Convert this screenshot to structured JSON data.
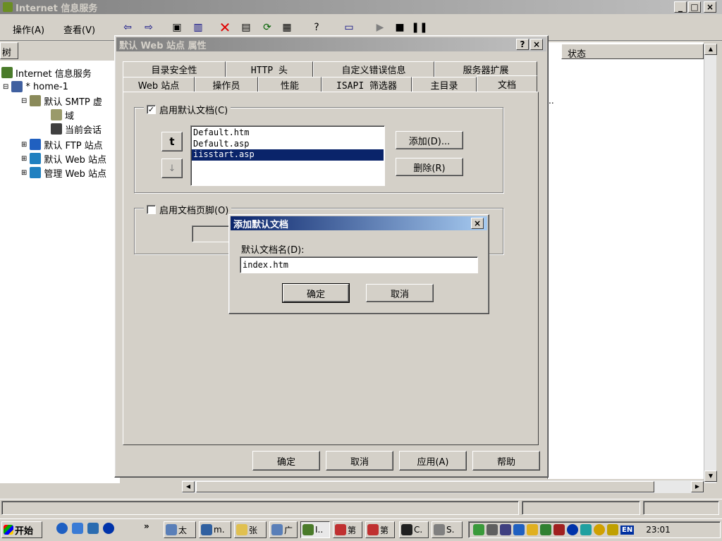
{
  "main_window": {
    "title": "Internet 信息服务",
    "caption_min": "_",
    "caption_max": "□",
    "caption_close": "×",
    "menu": [
      {
        "label": "操作(A)"
      },
      {
        "label": "查看(V)"
      }
    ]
  },
  "left_pane": {
    "header": "树",
    "tree": [
      {
        "label": "Internet 信息服务"
      },
      {
        "label": "* home-1"
      },
      {
        "label": "默认 SMTP 虚"
      },
      {
        "label": "域"
      },
      {
        "label": "当前会话"
      },
      {
        "label": "默认 FTP 站点"
      },
      {
        "label": "默认 Web 站点"
      },
      {
        "label": "管理 Web 站点"
      }
    ]
  },
  "right_pane": {
    "column_status": "状态",
    "ellipsis": ".."
  },
  "properties_dialog": {
    "title": "默认 Web 站点 属性",
    "help_btn": "?",
    "close_btn": "×",
    "tabs_row1": [
      "目录安全性",
      "HTTP 头",
      "自定义错误信息",
      "服务器扩展"
    ],
    "tabs_row2": [
      "Web 站点",
      "操作员",
      "性能",
      "ISAPI 筛选器",
      "主目录",
      "文档"
    ],
    "enable_default_doc": "启用默认文档(C)",
    "enable_default_doc_checked": true,
    "up_arrow": "t",
    "down_arrow": "↓",
    "doc_list": [
      "Default.htm",
      "Default.asp",
      "iisstart.asp"
    ],
    "selected_doc_index": 2,
    "add_btn": "添加(D)...",
    "remove_btn": "删除(R)",
    "enable_footer": "启用文档页脚(O)",
    "enable_footer_checked": false,
    "ok": "确定",
    "cancel": "取消",
    "apply": "应用(A)",
    "help": "帮助"
  },
  "add_dialog": {
    "title": "添加默认文档",
    "close_btn": "×",
    "label": "默认文档名(D):",
    "value": "index.htm",
    "ok": "确定",
    "cancel": "取消"
  },
  "taskbar": {
    "start": "开始",
    "chevron": "»",
    "tasks": [
      "太",
      "m.",
      "张",
      "广",
      "I..",
      "第",
      "第",
      "C.",
      "S."
    ],
    "tray_lang": "EN",
    "clock": "23:01"
  }
}
